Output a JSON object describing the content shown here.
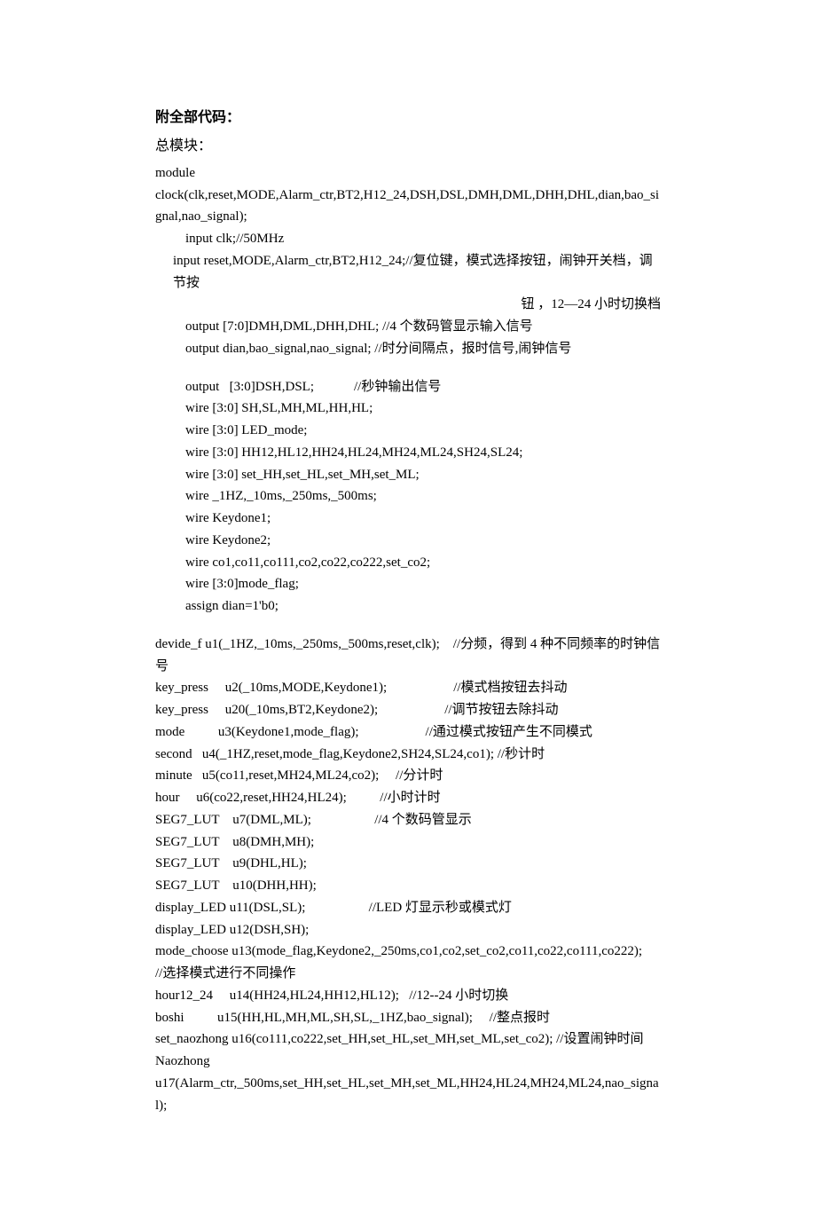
{
  "title": "附全部代码：",
  "subtitle": "总模块：",
  "lines": [
    {
      "cls": "line",
      "txt": "module"
    },
    {
      "cls": "line",
      "txt": "clock(clk,reset,MODE,Alarm_ctr,BT2,H12_24,DSH,DSL,DMH,DML,DHH,DHL,dian,bao_signal,nao_signal);"
    },
    {
      "cls": "line indent1",
      "txt": "input clk;//50MHz"
    },
    {
      "cls": "line indent2",
      "txt": "input reset,MODE,Alarm_ctr,BT2,H12_24;//复位键，模式选择按钮，闹钟开关档，调节按"
    },
    {
      "cls": "line right-note",
      "txt": "钮 ，12—24 小时切换档"
    },
    {
      "cls": "line indent1",
      "txt": "output [7:0]DMH,DML,DHH,DHL; //4 个数码管显示输入信号"
    },
    {
      "cls": "line indent1",
      "txt": "output dian,bao_signal,nao_signal; //时分间隔点，报时信号,闹钟信号"
    },
    {
      "cls": "blank",
      "txt": ""
    },
    {
      "cls": "line indent1",
      "txt": "output   [3:0]DSH,DSL;            //秒钟输出信号"
    },
    {
      "cls": "line indent1",
      "txt": "wire [3:0] SH,SL,MH,ML,HH,HL;"
    },
    {
      "cls": "line indent1",
      "txt": "wire [3:0] LED_mode;"
    },
    {
      "cls": "line indent1",
      "txt": "wire [3:0] HH12,HL12,HH24,HL24,MH24,ML24,SH24,SL24;"
    },
    {
      "cls": "line indent1",
      "txt": "wire [3:0] set_HH,set_HL,set_MH,set_ML;"
    },
    {
      "cls": "line indent1",
      "txt": "wire _1HZ,_10ms,_250ms,_500ms;"
    },
    {
      "cls": "line indent1",
      "txt": "wire Keydone1;"
    },
    {
      "cls": "line indent1",
      "txt": "wire Keydone2;"
    },
    {
      "cls": "line indent1",
      "txt": "wire co1,co11,co111,co2,co22,co222,set_co2;"
    },
    {
      "cls": "line indent1",
      "txt": "wire [3:0]mode_flag;"
    },
    {
      "cls": "line indent1",
      "txt": "assign dian=1'b0;"
    },
    {
      "cls": "blank",
      "txt": ""
    },
    {
      "cls": "line",
      "txt": "devide_f u1(_1HZ,_10ms,_250ms,_500ms,reset,clk);    //分频，得到 4 种不同频率的时钟信号"
    },
    {
      "cls": "line",
      "txt": "key_press     u2(_10ms,MODE,Keydone1);                    //模式档按钮去抖动"
    },
    {
      "cls": "line",
      "txt": "key_press     u20(_10ms,BT2,Keydone2);                    //调节按钮去除抖动"
    },
    {
      "cls": "line",
      "txt": "mode          u3(Keydone1,mode_flag);                    //通过模式按钮产生不同模式"
    },
    {
      "cls": "line",
      "txt": "second   u4(_1HZ,reset,mode_flag,Keydone2,SH24,SL24,co1); //秒计时"
    },
    {
      "cls": "line",
      "txt": "minute   u5(co11,reset,MH24,ML24,co2);     //分计时"
    },
    {
      "cls": "line",
      "txt": "hour     u6(co22,reset,HH24,HL24);          //小时计时"
    },
    {
      "cls": "line",
      "txt": "SEG7_LUT    u7(DML,ML);                   //4 个数码管显示"
    },
    {
      "cls": "line",
      "txt": "SEG7_LUT    u8(DMH,MH);"
    },
    {
      "cls": "line",
      "txt": "SEG7_LUT    u9(DHL,HL);"
    },
    {
      "cls": "line",
      "txt": "SEG7_LUT    u10(DHH,HH);"
    },
    {
      "cls": "line",
      "txt": "display_LED u11(DSL,SL);                   //LED 灯显示秒或模式灯"
    },
    {
      "cls": "line",
      "txt": "display_LED u12(DSH,SH);"
    },
    {
      "cls": "line",
      "txt": "mode_choose u13(mode_flag,Keydone2,_250ms,co1,co2,set_co2,co11,co22,co111,co222);    //选择模式进行不同操作"
    },
    {
      "cls": "line",
      "txt": "hour12_24     u14(HH24,HL24,HH12,HL12);   //12--24 小时切换"
    },
    {
      "cls": "line",
      "txt": "boshi          u15(HH,HL,MH,ML,SH,SL,_1HZ,bao_signal);     //整点报时"
    },
    {
      "cls": "line",
      "txt": "set_naozhong u16(co111,co222,set_HH,set_HL,set_MH,set_ML,set_co2); //设置闹钟时间"
    },
    {
      "cls": "line",
      "txt": "Naozhong"
    },
    {
      "cls": "line",
      "txt": "u17(Alarm_ctr,_500ms,set_HH,set_HL,set_MH,set_ML,HH24,HL24,MH24,ML24,nao_signal);"
    }
  ]
}
